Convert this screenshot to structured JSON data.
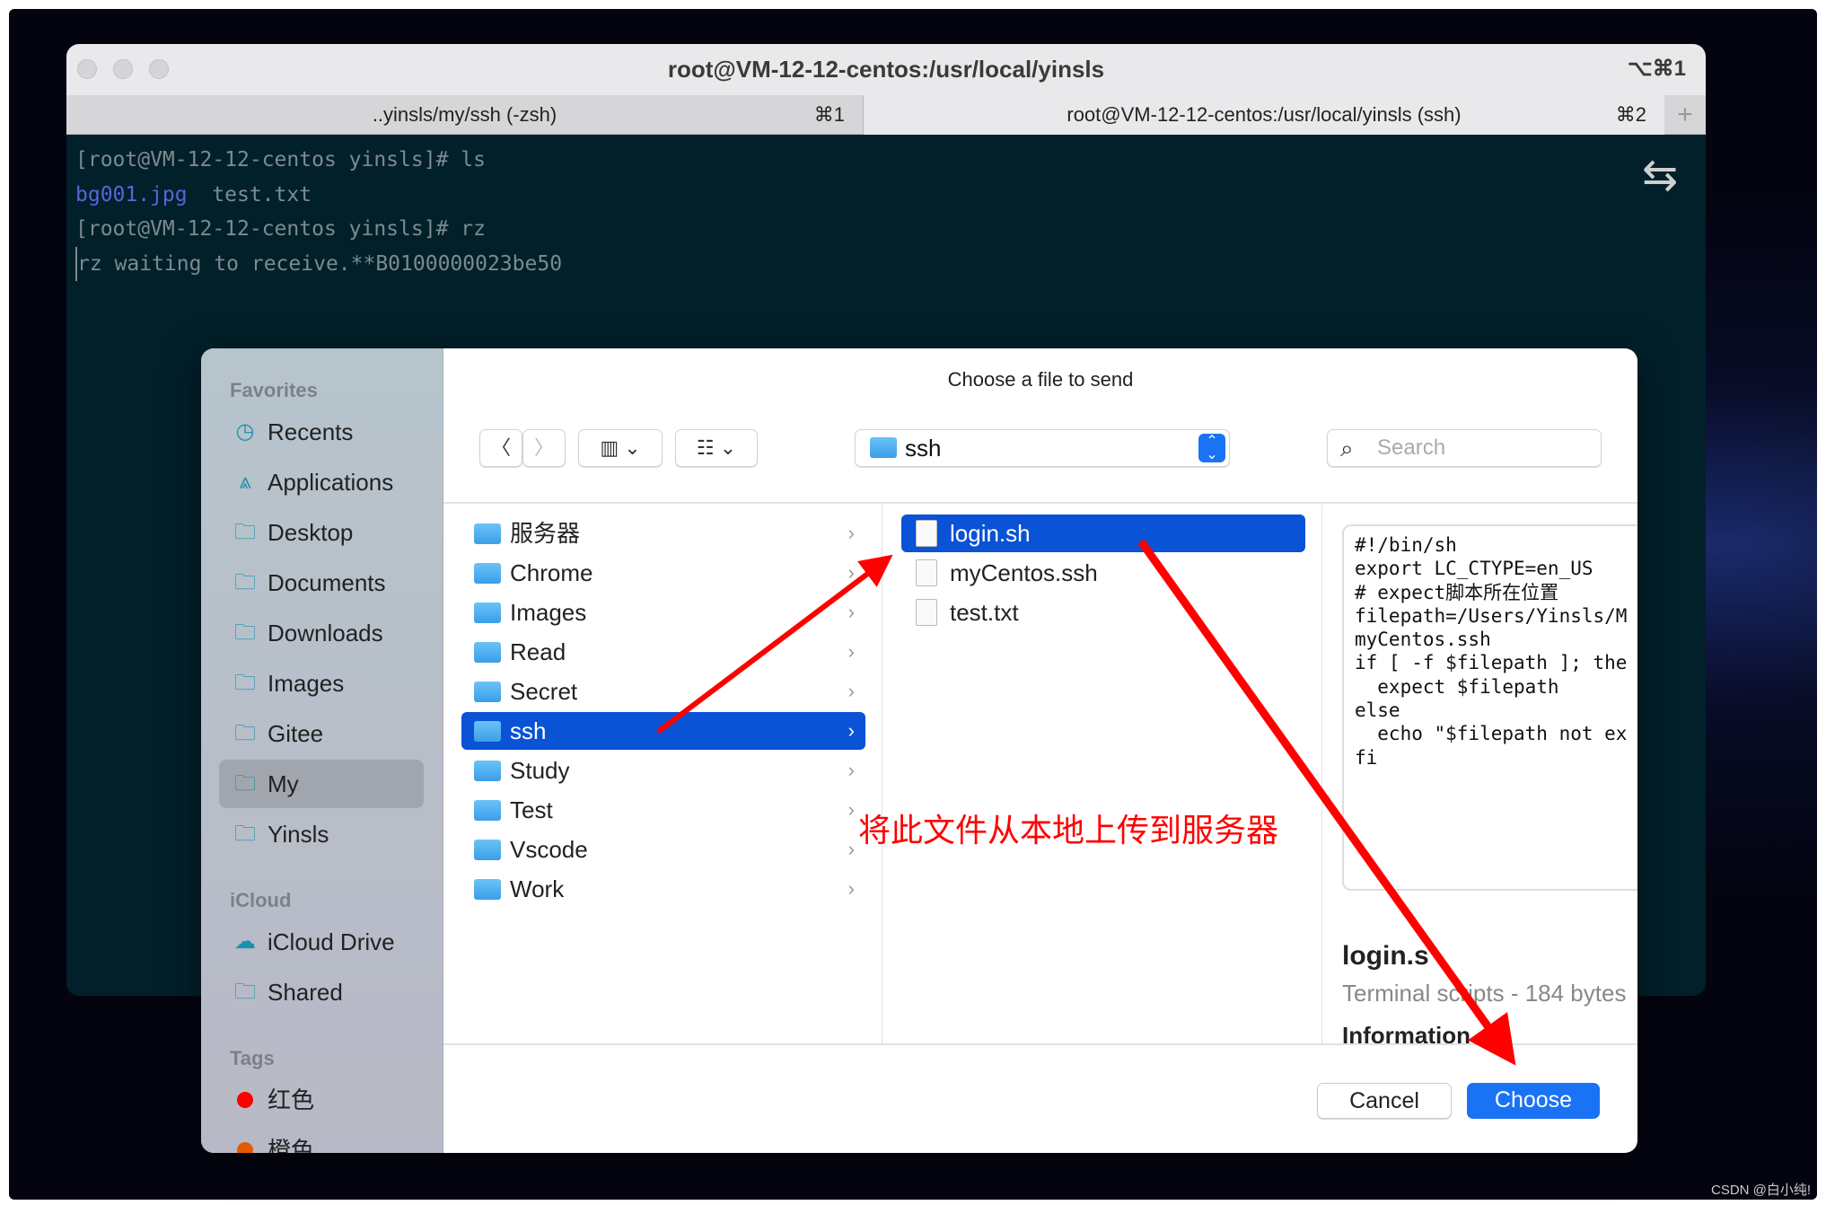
{
  "terminal": {
    "title": "root@VM-12-12-centos:/usr/local/yinsls",
    "title_shortcut": "⌥⌘1",
    "tabs": [
      {
        "label": "..yinsls/my/ssh (-zsh)",
        "shortcut": "⌘1"
      },
      {
        "label": "root@VM-12-12-centos:/usr/local/yinsls (ssh)",
        "shortcut": "⌘2"
      }
    ],
    "new_tab": "+",
    "lines": [
      "[root@VM-12-12-centos yinsls]# ls",
      "bg001.jpg",
      "  test.txt",
      "[root@VM-12-12-centos yinsls]# rz",
      "rz waiting to receive.**B0100000023be50"
    ],
    "colors": {
      "background": "#02202a",
      "text": "#7b8b90",
      "image_file": "#5a63d8"
    }
  },
  "dialog": {
    "title": "Choose a file to send",
    "location": "ssh",
    "search_placeholder": "Search",
    "sidebar": {
      "favorites_heading": "Favorites",
      "favorites": [
        {
          "label": "Recents",
          "icon": "clock-icon"
        },
        {
          "label": "Applications",
          "icon": "apps-icon"
        },
        {
          "label": "Desktop",
          "icon": "folder-icon"
        },
        {
          "label": "Documents",
          "icon": "folder-icon"
        },
        {
          "label": "Downloads",
          "icon": "folder-icon"
        },
        {
          "label": "Images",
          "icon": "folder-icon"
        },
        {
          "label": "Gitee",
          "icon": "folder-icon"
        },
        {
          "label": "My",
          "icon": "folder-icon",
          "selected": true
        },
        {
          "label": "Yinsls",
          "icon": "folder-icon"
        }
      ],
      "icloud_heading": "iCloud",
      "icloud": [
        {
          "label": "iCloud Drive",
          "icon": "cloud-icon"
        },
        {
          "label": "Shared",
          "icon": "shared-folder-icon"
        }
      ],
      "tags_heading": "Tags",
      "tags": [
        {
          "label": "红色",
          "color": "#ff0000"
        },
        {
          "label": "橙色",
          "color": "#e35a00"
        }
      ]
    },
    "column1": [
      "服务器",
      "Chrome",
      "Images",
      "Read",
      "Secret",
      "ssh",
      "Study",
      "Test",
      "Vscode",
      "Work"
    ],
    "column1_selected": "ssh",
    "column2": [
      "login.sh",
      "myCentos.ssh",
      "test.txt"
    ],
    "column2_selected": "login.sh",
    "preview": {
      "content": "#!/bin/sh\nexport LC_CTYPE=en_US\n# expect脚本所在位置\nfilepath=/Users/Yinsls/M\nmyCentos.ssh\nif [ -f $filepath ]; the\n  expect $filepath\nelse\n  echo \"$filepath not ex\nfi",
      "name": "login.s",
      "kind": "Terminal scripts - 184 bytes",
      "info_heading": "Information"
    },
    "cancel": "Cancel",
    "choose": "Choose",
    "accent": "#0a52d6"
  },
  "annotation": "将此文件从本地上传到服务器",
  "watermark": "CSDN @白小纯!"
}
